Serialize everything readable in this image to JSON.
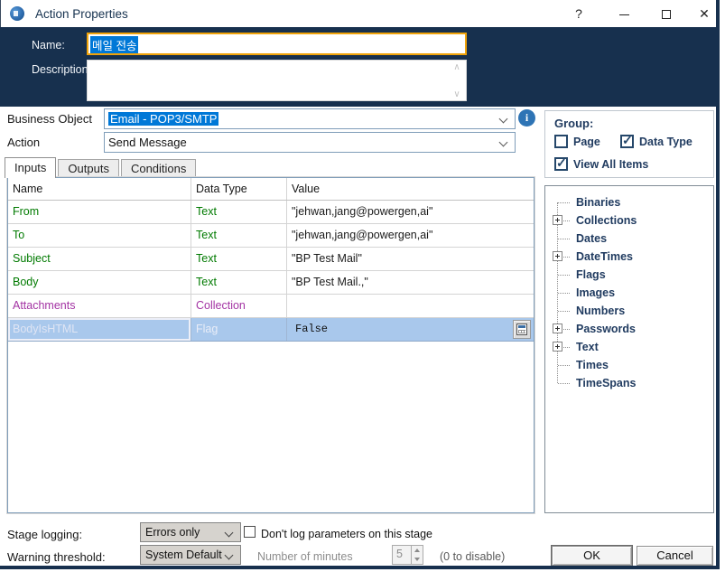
{
  "window": {
    "title": "Action Properties",
    "help_glyph": "?",
    "close_glyph": "✕"
  },
  "header": {
    "name_label": "Name:",
    "name_value": "메일 전송",
    "description_label": "Description:",
    "description_value": ""
  },
  "business_object": {
    "label": "Business Object",
    "value": "Email - POP3/SMTP"
  },
  "action": {
    "label": "Action",
    "value": "Send Message"
  },
  "tabs": [
    {
      "label": "Inputs",
      "active": true
    },
    {
      "label": "Outputs",
      "active": false
    },
    {
      "label": "Conditions",
      "active": false
    }
  ],
  "inputs_table": {
    "columns": {
      "name": "Name",
      "type": "Data Type",
      "value": "Value"
    },
    "rows": [
      {
        "name": "From",
        "type": "Text",
        "value": "\"jehwan,jang@powergen,ai\"",
        "color": "green"
      },
      {
        "name": "To",
        "type": "Text",
        "value": "\"jehwan,jang@powergen,ai\"",
        "color": "green"
      },
      {
        "name": "Subject",
        "type": "Text",
        "value": "\"BP Test Mail\"",
        "color": "green"
      },
      {
        "name": "Body",
        "type": "Text",
        "value": "\"BP Test Mail.,\"",
        "color": "green"
      },
      {
        "name": "Attachments",
        "type": "Collection",
        "value": "",
        "color": "magenta"
      },
      {
        "name": "BodyIsHTML",
        "type": "Flag",
        "value": "False",
        "color": "selected"
      }
    ]
  },
  "group_panel": {
    "title": "Group:",
    "checkboxes": [
      {
        "label": "Page",
        "checked": false
      },
      {
        "label": "Data Type",
        "checked": true
      },
      {
        "label": "View All Items",
        "checked": true
      }
    ]
  },
  "tree": {
    "items": [
      {
        "label": "Binaries",
        "expandable": false
      },
      {
        "label": "Collections",
        "expandable": true
      },
      {
        "label": "Dates",
        "expandable": false
      },
      {
        "label": "DateTimes",
        "expandable": true
      },
      {
        "label": "Flags",
        "expandable": false
      },
      {
        "label": "Images",
        "expandable": false
      },
      {
        "label": "Numbers",
        "expandable": false
      },
      {
        "label": "Passwords",
        "expandable": true
      },
      {
        "label": "Text",
        "expandable": true
      },
      {
        "label": "Times",
        "expandable": false
      },
      {
        "label": "TimeSpans",
        "expandable": false
      }
    ]
  },
  "footer": {
    "stage_logging_label": "Stage logging:",
    "stage_logging_value": "Errors only",
    "dont_log_label": "Don't log parameters on this stage",
    "dont_log_checked": false,
    "warning_threshold_label": "Warning threshold:",
    "warning_threshold_value": "System Default",
    "minutes_label": "Number of minutes",
    "minutes_value": "5",
    "disable_hint": "(0 to disable)"
  },
  "buttons": {
    "ok": "OK",
    "cancel": "Cancel"
  },
  "colors": {
    "navy_panel": "#17304E",
    "name_field_border": "#F0A30A",
    "selection_blue": "#0078D7",
    "input_text_green": "#007A00",
    "collection_magenta": "#A333A3",
    "selected_row_bg": "#A9C8EC",
    "tree_text_navy": "#1F3A5F",
    "info_icon_blue": "#2E74B5",
    "classic_combo_bg": "#D6D3CE"
  }
}
